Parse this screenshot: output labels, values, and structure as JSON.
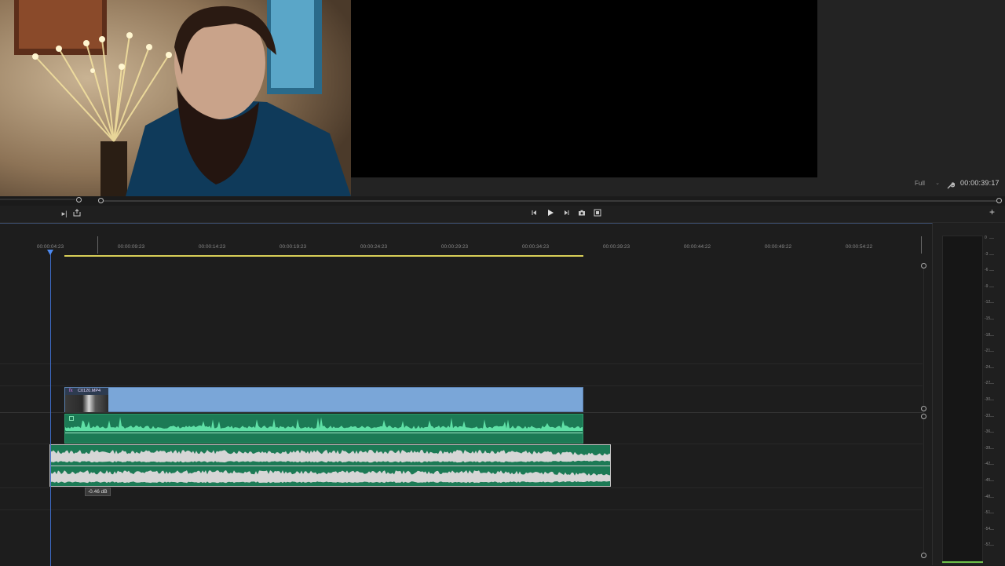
{
  "program_monitor": {
    "zoom": "Full",
    "timecode": "00:00:39:17"
  },
  "timeline": {
    "ruler_labels": [
      "00:00:04:23",
      "00:00:09:23",
      "00:00:14:23",
      "00:00:19:23",
      "00:00:24:23",
      "00:00:29:23",
      "00:00:34:23",
      "00:00:39:23",
      "00:00:44:22",
      "00:00:49:22",
      "00:00:54:22"
    ],
    "video_clip_label": "C0120.MP4",
    "fx_badge": "fx",
    "db_tooltip": "-0.46 dB"
  },
  "meters": {
    "db_labels": [
      "0",
      "-3",
      "-6",
      "-9",
      "-12",
      "-15",
      "-18",
      "-21",
      "-24",
      "-27",
      "-30",
      "-33",
      "-36",
      "-39",
      "-42",
      "-45",
      "-48",
      "-51",
      "-54",
      "-57"
    ]
  },
  "icons": {
    "transport": [
      "step-back-icon",
      "play-icon",
      "step-forward-icon",
      "camera-icon",
      "export-frame-icon"
    ],
    "plus": "+"
  },
  "colors": {
    "video_clip": "#7aa6d8",
    "audio_clip": "#1c7a55",
    "waveform": "#5fe0a6",
    "playhead": "#4d8af0",
    "work_area": "#d8cf58"
  }
}
